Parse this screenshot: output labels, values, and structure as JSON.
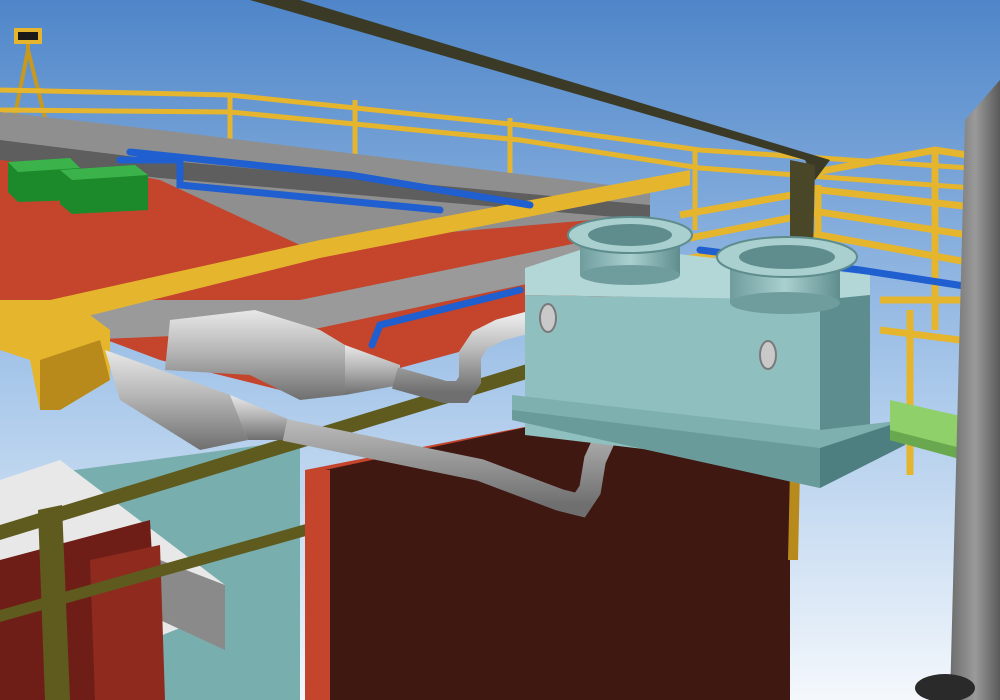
{
  "scene": {
    "kind": "3D plant model render",
    "colors": {
      "sky_top": "#4f86c9",
      "sky_bottom": "#f4f8fc",
      "railing": "#e5b52e",
      "railing_dark": "#b88a1c",
      "girder": "#3b3a26",
      "floor_red": "#c4442c",
      "wall_red_dark": "#3f1812",
      "teal_box": "#8fbfbe",
      "teal_dark": "#5d8d8e",
      "teal_light": "#b3d7d6",
      "duct_gray": "#a9a9a9",
      "duct_light": "#d4d4d4",
      "pipe_blue": "#1f5fcf",
      "green_equipment": "#1c8a2b",
      "green_beam": "#8fd06b",
      "concrete": "#8f8f8f",
      "column_gray": "#7d7d7d"
    },
    "components": [
      "steel-girder",
      "safety-railing",
      "cable-tray",
      "red-deck",
      "ventilation-duct",
      "reducer-cone",
      "pipe-elbow",
      "teal-plenum-box",
      "round-flange-outlet",
      "blue-water-pipe",
      "green-electrical-cabinet",
      "green-support-beam",
      "gray-column"
    ]
  }
}
